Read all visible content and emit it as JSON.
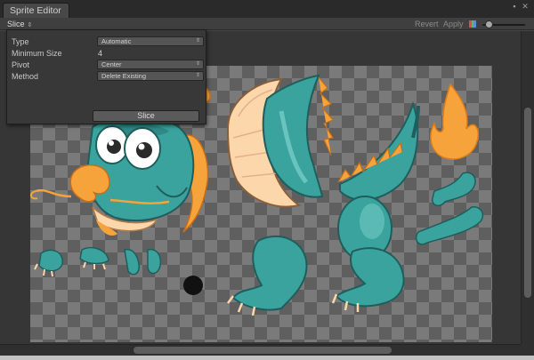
{
  "window": {
    "title": "Sprite Editor"
  },
  "toolbar": {
    "slice_label": "Slice",
    "revert_label": "Revert",
    "apply_label": "Apply",
    "accent_color": "#5b8fd6"
  },
  "slice_popup": {
    "type": {
      "label": "Type",
      "value": "Automatic"
    },
    "minimum_size": {
      "label": "Minimum Size",
      "value": "4"
    },
    "pivot": {
      "label": "Pivot",
      "value": "Center"
    },
    "method": {
      "label": "Method",
      "value": "Delete Existing"
    },
    "slice_button_label": "Slice"
  },
  "icons": {
    "dropdown_arrow": "⇕",
    "caret": "⇕",
    "window_menu": "▪",
    "window_close": "✕"
  },
  "sprite_sheet": {
    "character": "dragon",
    "palette": {
      "teal": "#3aa39e",
      "teal_dark": "#26706e",
      "orange": "#f5a33a",
      "cream": "#fbd7ab"
    }
  }
}
